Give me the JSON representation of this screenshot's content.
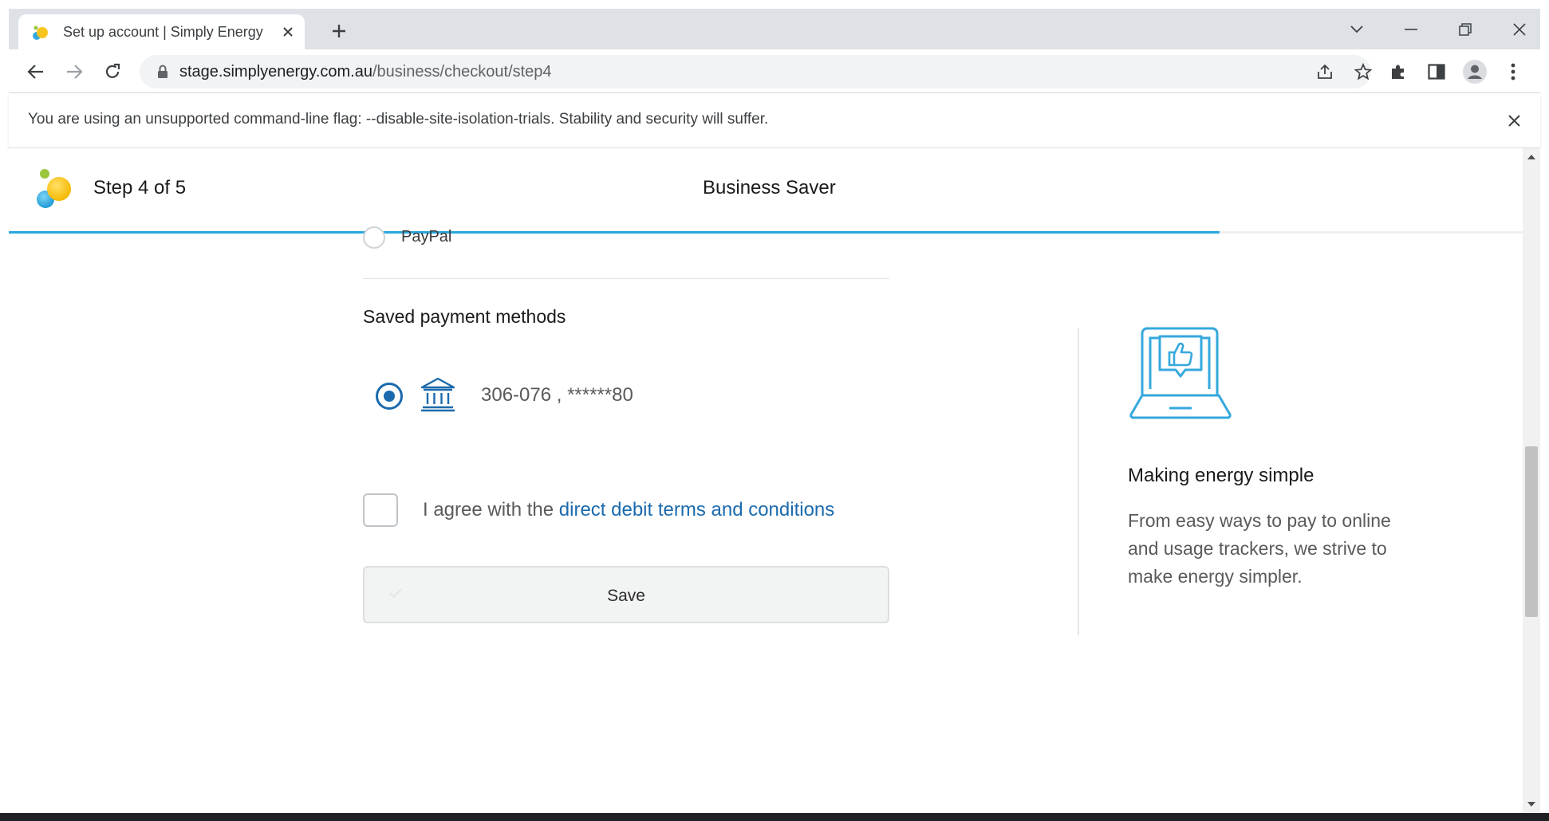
{
  "browser": {
    "tab_title": "Set up account | Simply Energy",
    "url_host": "stage.simplyenergy.com.au",
    "url_path": "/business/checkout/step4",
    "infobar_message": "You are using an unsupported command-line flag: --disable-site-isolation-trials. Stability and security will suffer."
  },
  "page": {
    "step_label": "Step 4 of 5",
    "plan_name": "Business Saver",
    "progress_fraction": 0.8,
    "paypal_label": "PayPal",
    "saved_methods_heading": "Saved payment methods",
    "saved_account": "306-076 , ******80",
    "agree_prefix": "I agree with the ",
    "agree_link": "direct debit terms and conditions",
    "save_label": "Save"
  },
  "sidebar": {
    "heading": "Making energy simple",
    "body": "From easy ways to pay to online and usage trackers, we strive to make energy simpler."
  },
  "colors": {
    "accent_blue": "#1b6aad",
    "progress_blue": "#2aa7dc",
    "icon_blue": "#35a8dd"
  }
}
